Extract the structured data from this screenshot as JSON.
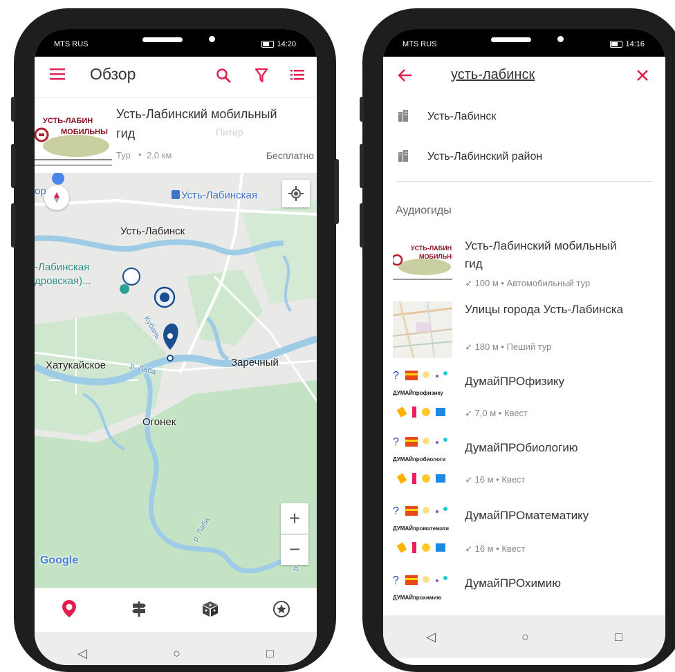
{
  "left": {
    "status": {
      "carrier": "MTS RUS",
      "time": "14:20"
    },
    "appbar": {
      "title": "Обзор"
    },
    "card": {
      "title_line1": "Усть-Лабинский мобильный",
      "title_line2": "гид",
      "type": "Тур",
      "distance": "2,0 км",
      "price": "Бесплатно",
      "thumb_line1": "УСТЬ-ЛАБИН",
      "thumb_line2": "МОБИЛЬНЫ",
      "bg_label": "Питер"
    },
    "map": {
      "labels": {
        "ust_lab_station": "Усть-Лабинская",
        "ust_lab_city": "Усть-Лабинск",
        "ust_lab_left1": "-Лабинская",
        "ust_lab_left2": "дровская)...",
        "khatukayskoe": "Хатукайское",
        "zarechny": "Заречный",
        "ogonek": "Огонек",
        "laba1": "р. Лаба",
        "kuban": "Кубань",
        "laba2": "р. Лаба",
        "laba3": "р. Л",
        "edge_text": "ор",
        "google": "Google"
      },
      "zoom_in": "+",
      "zoom_out": "−"
    }
  },
  "right": {
    "status": {
      "carrier": "MTS RUS",
      "time": "14:16"
    },
    "search": {
      "query": "усть-лабинск"
    },
    "places": [
      "Усть-Лабинск",
      "Усть-Лабинский район"
    ],
    "section_title": "Аудиогиды",
    "guides": [
      {
        "title_line1": "Усть-Лабинский мобильный",
        "title_line2": "гид",
        "distance": "100 м",
        "type": "Автомобильный тур"
      },
      {
        "title_line1": "Улицы города Усть-Лабинска",
        "title_line2": "",
        "distance": "180 м",
        "type": "Пеший тур"
      },
      {
        "title_line1": "ДумайПРОфизику",
        "title_line2": "",
        "distance": "7,0 м",
        "type": "Квест",
        "thumb_caption": "ДУМАЙпрофизику"
      },
      {
        "title_line1": "ДумайПРОбиологию",
        "title_line2": "",
        "distance": "16 м",
        "type": "Квест",
        "thumb_caption": "ДУМАЙпробиологи"
      },
      {
        "title_line1": "ДумайПРОматематику",
        "title_line2": "",
        "distance": "16 м",
        "type": "Квест",
        "thumb_caption": "ДУМАЙпроматемати"
      },
      {
        "title_line1": "ДумайПРОхимию",
        "title_line2": "",
        "distance": "",
        "type": "",
        "thumb_caption": "ДУМАЙпрохимию"
      }
    ]
  },
  "colors": {
    "accent": "#e01f4f",
    "map_water": "#9ecbe6",
    "map_green": "#c8e6c9",
    "pin": "#1a4d8f"
  }
}
